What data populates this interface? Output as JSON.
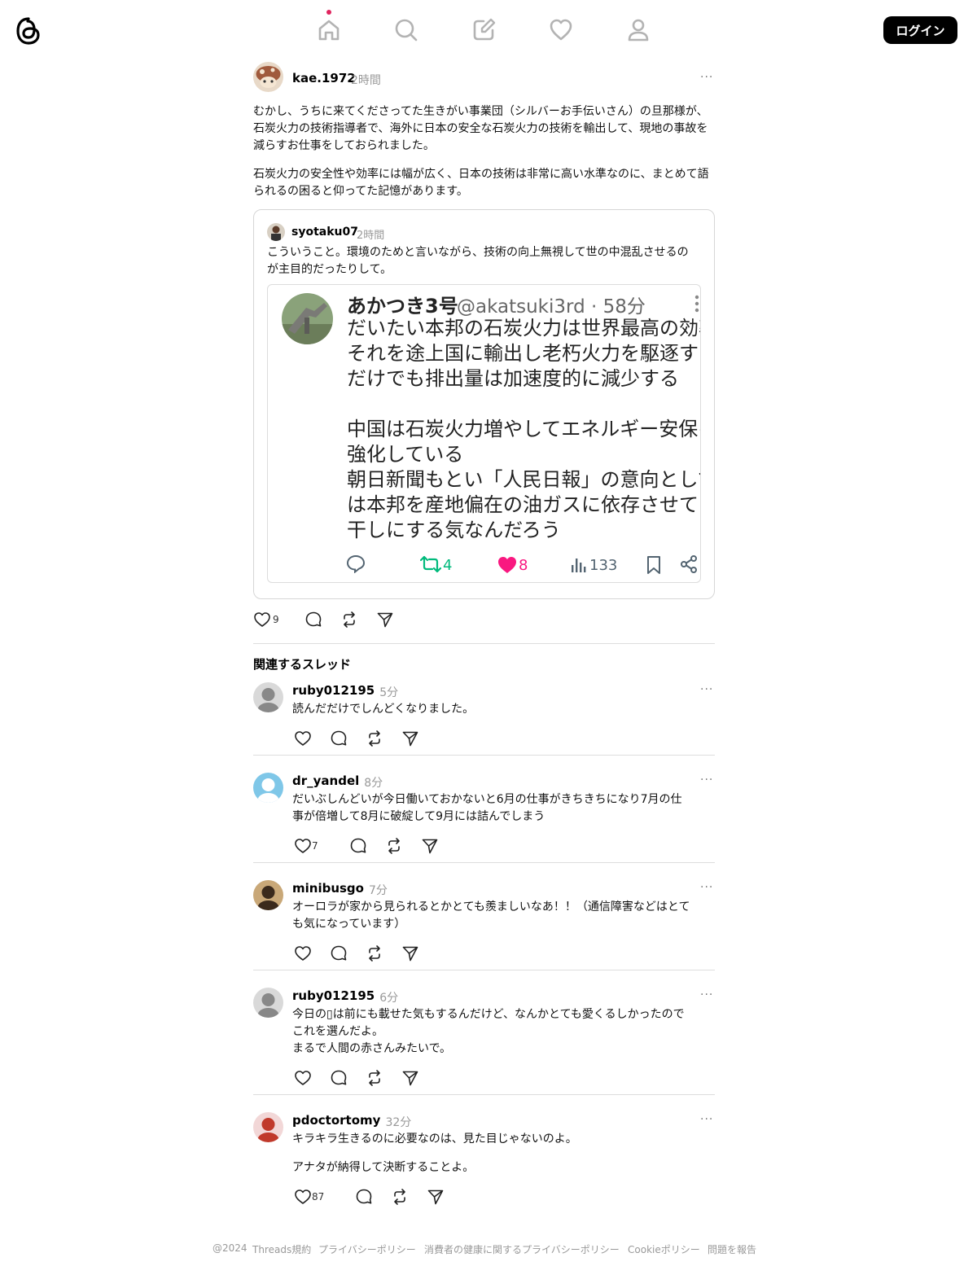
{
  "header": {
    "login_label": "ログイン"
  },
  "post": {
    "username": "kae.1972",
    "time": "2時間",
    "more": "···",
    "paragraph1": "むかし、うちに来てくださってた生きがい事業団（シルバーお手伝いさん）の旦那様が、石炭火力の技術指導者で、海外に日本の安全な石炭火力の技術を輸出して、現地の事故を減らすお仕事をしておられました。",
    "paragraph2": "石炭火力の安全性や効率には幅が広く、日本の技術は非常に高い水準なのに、まとめて語られるの困ると仰ってた記憶があります。",
    "like_count": "9"
  },
  "quote": {
    "username": "syotaku07",
    "time": "2時間",
    "text": "こういうこと。環境のためと言いながら、技術の向上無視して世の中混乱させるのが主目的だったりして。",
    "tweet": {
      "name": "あかつき3号",
      "handle": "@akatsuki3rd · 58分",
      "body": "だいたい本邦の石炭火力は世界最高の効率\nそれを途上国に輸出し老朽火力を駆逐する\nだけでも排出量は加速度的に減少する\n\n中国は石炭火力増やしてエネルギー安保を\n強化している\n朝日新聞もとい「人民日報」の意向として\nは本邦を産地偏在の油ガスに依存させて日\n干しにする気なんだろう",
      "retweets": "4",
      "likes": "8",
      "views": "133",
      "retweet_color": "#00ba7c",
      "like_color": "#f91880"
    }
  },
  "related": {
    "title": "関連するスレッド",
    "threads": [
      {
        "username": "ruby012195",
        "time": "5分",
        "lines": [
          "読んだだけでしんどくなりました。"
        ],
        "like_count": ""
      },
      {
        "username": "dr_yandel",
        "time": "8分",
        "lines": [
          "だいぶしんどいが今日働いておかないと6月の仕事がきちきちになり7月の仕",
          "事が倍増して8月に破綻して9月には詰んでしまう"
        ],
        "like_count": "7"
      },
      {
        "username": "minibusgo",
        "time": "7分",
        "lines": [
          "オーロラが家から見られるとかとても羨ましいなあ！！（通信障害などはとて",
          "も気になっています）"
        ],
        "like_count": ""
      },
      {
        "username": "ruby012195",
        "time": "6分",
        "lines": [
          "今日の▯​は前にも載せた気もするんだけど、なんかとても愛くるしかったので",
          "これを選んだよ。",
          "まるで人間の赤さんみたいで。"
        ],
        "like_count": ""
      },
      {
        "username": "pdoctortomy",
        "time": "32分",
        "lines": [
          "キラキラ生きるのに必要なのは、見た目じゃないのよ。",
          "",
          "アナタが納得して決断することよ。"
        ],
        "like_count": "87"
      }
    ]
  },
  "footer": {
    "items": [
      "@2024",
      "Threads規約",
      "プライバシーポリシー",
      "消費者の健康に関するプライバシーポリシー",
      "Cookieポリシー",
      "問題を報告"
    ]
  }
}
